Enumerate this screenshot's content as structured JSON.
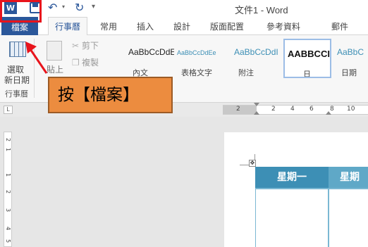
{
  "quick_access": {
    "app_icon": "word-icon",
    "save_icon": "save-icon",
    "undo_icon": "undo-icon",
    "redo_icon": "redo-icon",
    "customize_icon": "chevron-down-icon"
  },
  "window": {
    "title": "文件1 - Word"
  },
  "tabs": {
    "file": "檔案",
    "items": [
      {
        "label": "行事曆",
        "active": true
      },
      {
        "label": "常用",
        "active": false
      },
      {
        "label": "插入",
        "active": false
      },
      {
        "label": "設計",
        "active": false
      },
      {
        "label": "版面配置",
        "active": false
      },
      {
        "label": "參考資料",
        "active": false
      },
      {
        "label": "郵件",
        "active": false
      }
    ]
  },
  "ribbon": {
    "calendar_group": {
      "button_line1": "選取",
      "button_line2": "新日期",
      "group_label": "行事曆"
    },
    "clipboard": {
      "paste_label": "貼上",
      "cut_label": "剪下",
      "copy_label": "複製"
    },
    "styles": [
      {
        "sample": "AaBbCcDdE",
        "name": "內文"
      },
      {
        "sample": "AaBbCcDdEe",
        "name": "表格文字"
      },
      {
        "sample": "AaBbCcDdI",
        "name": "附注"
      },
      {
        "sample": "AABBCCI",
        "name": "日"
      },
      {
        "sample": "AaBbC",
        "name": "日期"
      }
    ]
  },
  "callout": {
    "text": "按【檔案】",
    "highlight_color": "#e8141c",
    "fill_color": "#ec8c3f"
  },
  "ruler": {
    "tab_selector": "L",
    "h_numbers": [
      "2",
      "2",
      "4",
      "6",
      "8",
      "10"
    ],
    "v_numbers": [
      "2",
      "1",
      "1",
      "2",
      "3",
      "4",
      "5"
    ]
  },
  "document": {
    "move_handle_icon": "move-icon",
    "table_headers": [
      "星期一",
      "星期"
    ]
  },
  "colors": {
    "accent": "#2b579a",
    "table_header": "#3d8fb5"
  }
}
